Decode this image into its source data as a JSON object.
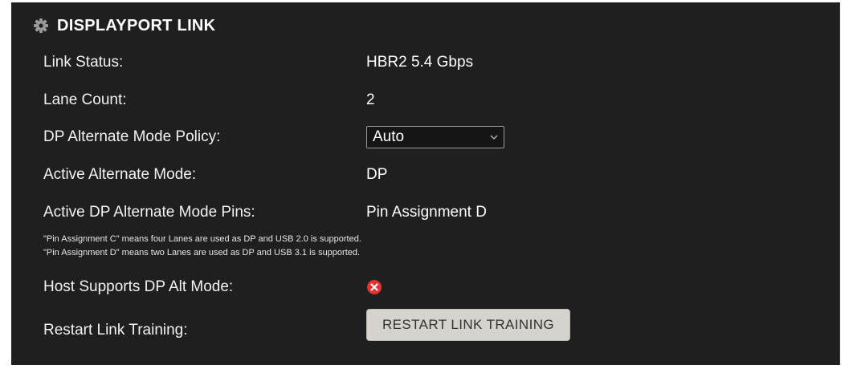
{
  "section": {
    "title": "DISPLAYPORT LINK",
    "icon": "gear-icon"
  },
  "rows": {
    "link_status": {
      "label": "Link Status:",
      "value": "HBR2 5.4 Gbps"
    },
    "lane_count": {
      "label": "Lane Count:",
      "value": "2"
    },
    "alt_mode_policy": {
      "label": "DP Alternate Mode Policy:",
      "selected": "Auto"
    },
    "active_alt_mode": {
      "label": "Active Alternate Mode:",
      "value": "DP"
    },
    "active_pins": {
      "label": "Active DP Alternate Mode Pins:",
      "value": "Pin Assignment D"
    },
    "host_supports": {
      "label": "Host Supports DP Alt Mode:",
      "status_icon": "error-circle-icon"
    },
    "restart_training": {
      "label": "Restart Link Training:",
      "button_label": "RESTART LINK TRAINING"
    }
  },
  "notes": [
    "\"Pin Assignment C\" means four Lanes are used as DP and USB 2.0 is supported.",
    "\"Pin Assignment D\" means two Lanes are used as DP and USB 3.1 is supported."
  ],
  "colors": {
    "panel_bg": "#1f1f1f",
    "text": "#f2f2f2",
    "error": "#e5322d",
    "button_bg": "#d6d3cf"
  }
}
